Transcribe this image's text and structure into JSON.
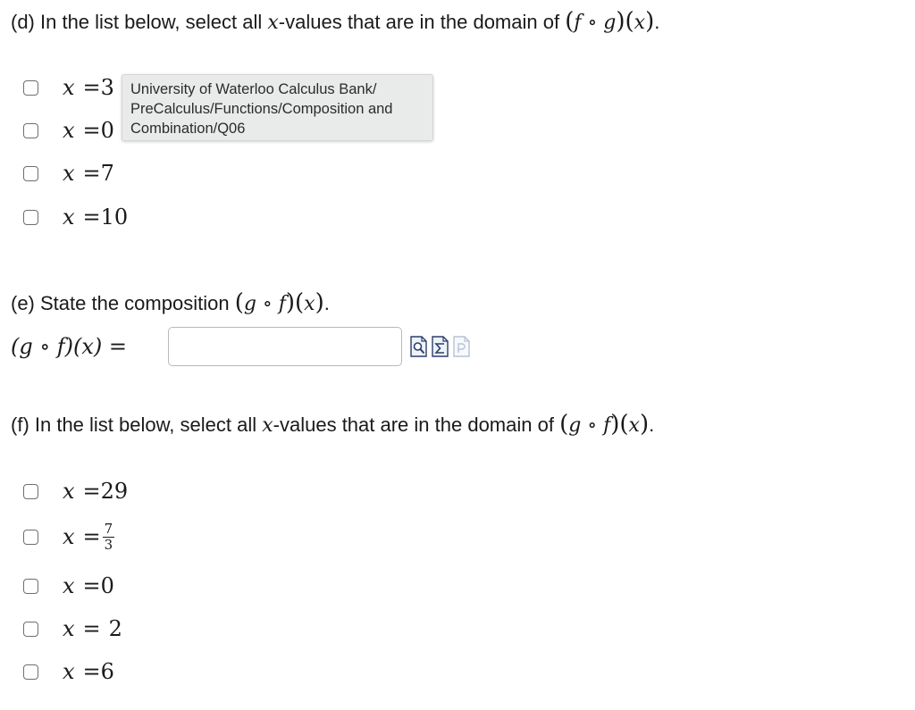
{
  "part_d": {
    "prefix": "(d) In the list below, select all ",
    "var": "x",
    "middle": "-values that are in the domain of ",
    "expr_inner": "f ∘ g",
    "expr_arg": "x",
    "suffix": ".",
    "options": [
      {
        "var": "x",
        "eq": "=",
        "value": "3"
      },
      {
        "var": "x",
        "eq": "=",
        "value": "0"
      },
      {
        "var": "x",
        "eq": "=",
        "value": "7"
      },
      {
        "var": "x",
        "eq": "=",
        "value": "10"
      }
    ]
  },
  "tooltip": {
    "lines": [
      "University of Waterloo Calculus Bank/",
      "PreCalculus/Functions/Composition and",
      "Combination/Q06"
    ]
  },
  "part_e": {
    "prefix": "(e) State the composition ",
    "expr_inner": "g ∘ f",
    "expr_arg": "x",
    "suffix": ".",
    "answer_lhs": "(g ∘ f)(x) =",
    "answer_value": "",
    "icons": [
      "preview-icon",
      "equation-editor-icon",
      "sage-icon"
    ]
  },
  "part_f": {
    "prefix": "(f) In the list below, select all ",
    "var": "x",
    "middle": "-values that are in the domain of ",
    "expr_inner": "g ∘ f",
    "expr_arg": "x",
    "suffix": ".",
    "options": [
      {
        "var": "x",
        "eq": "=",
        "value": "29"
      },
      {
        "var": "x",
        "eq": "=",
        "numerator": "7",
        "denominator": "3"
      },
      {
        "var": "x",
        "eq": "=",
        "value": "0"
      },
      {
        "var": "x",
        "eq": "=",
        "value": "2"
      },
      {
        "var": "x",
        "eq": "=",
        "value": "6"
      }
    ]
  }
}
